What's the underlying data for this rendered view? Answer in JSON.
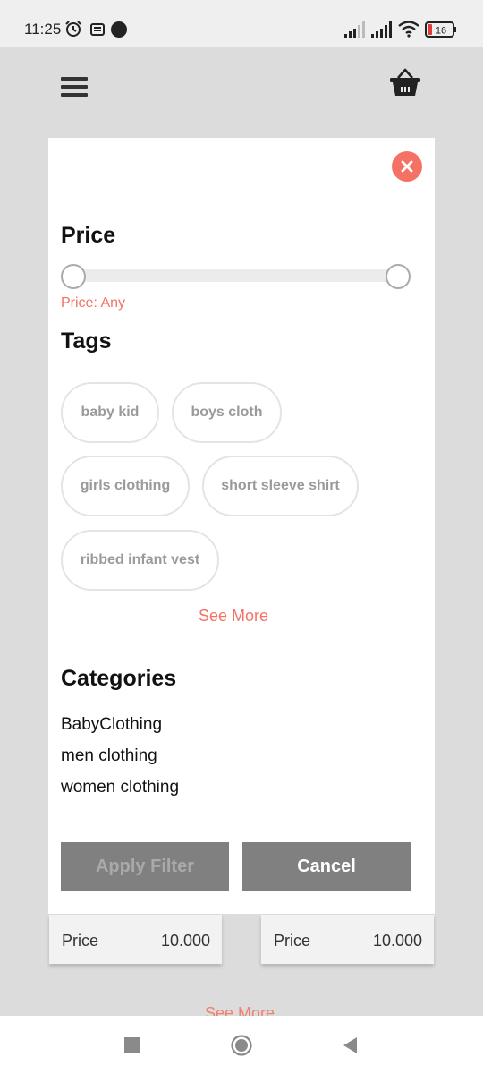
{
  "status_bar": {
    "time": "11:25",
    "battery_level": "16",
    "icons": [
      "alarm-icon",
      "notification-icon",
      "dot-icon",
      "signal-icon",
      "signal-icon",
      "wifi-icon",
      "battery-icon"
    ]
  },
  "header": {
    "menu_icon": "hamburger-menu-icon",
    "cart_icon": "basket-icon"
  },
  "background_products": [
    {
      "price_label": "Price",
      "price_value": "10.000"
    },
    {
      "price_label": "Price",
      "price_value": "10.000"
    }
  ],
  "background_see_more": "See More",
  "filter": {
    "close_icon": "close-icon",
    "price": {
      "title": "Price",
      "status": "Price: Any",
      "range_min_fraction": 0,
      "range_max_fraction": 1
    },
    "tags": {
      "title": "Tags",
      "items": [
        "baby kid",
        "boys cloth",
        "girls clothing",
        "short sleeve shirt",
        "ribbed infant vest"
      ],
      "see_more": "See More"
    },
    "categories": {
      "title": "Categories",
      "items": [
        "BabyClothing",
        "men clothing",
        "women clothing"
      ]
    },
    "apply_label": "Apply Filter",
    "cancel_label": "Cancel"
  },
  "colors": {
    "accent": "#f47264",
    "button_gray": "#808080",
    "overlay_gray": "#dcdcdc"
  }
}
